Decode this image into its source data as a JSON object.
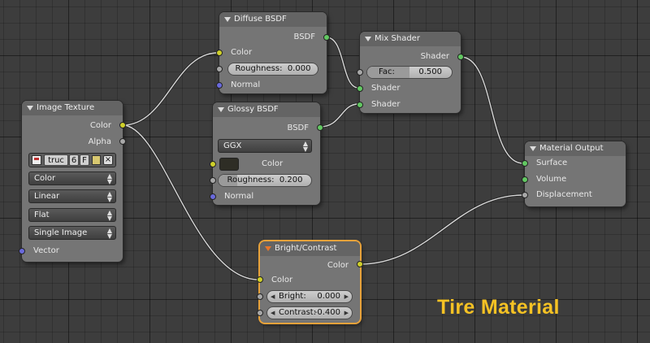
{
  "overlay_title": "Tire Material",
  "nodes": {
    "image_texture": {
      "title": "Image Texture",
      "outputs": [
        "Color",
        "Alpha"
      ],
      "image_name": "truc",
      "users": "6",
      "fake_user": "F",
      "dropdowns": [
        "Color",
        "Linear",
        "Flat",
        "Single Image"
      ],
      "input": "Vector"
    },
    "diffuse": {
      "title": "Diffuse BSDF",
      "output": "BSDF",
      "input_color": "Color",
      "roughness_label": "Roughness:",
      "roughness_value": "0.000",
      "input_normal": "Normal"
    },
    "glossy": {
      "title": "Glossy BSDF",
      "output": "BSDF",
      "distribution": "GGX",
      "input_color": "Color",
      "roughness_label": "Roughness:",
      "roughness_value": "0.200",
      "input_normal": "Normal"
    },
    "mix": {
      "title": "Mix Shader",
      "output": "Shader",
      "fac_label": "Fac:",
      "fac_value": "0.500",
      "fac_fraction": 0.5,
      "input_shader1": "Shader",
      "input_shader2": "Shader"
    },
    "output": {
      "title": "Material Output",
      "inputs": [
        "Surface",
        "Volume",
        "Displacement"
      ]
    },
    "bright_contrast": {
      "title": "Bright/Contrast",
      "output": "Color",
      "input_color": "Color",
      "bright_label": "Bright:",
      "bright_value": "0.000",
      "contrast_label": "Contrast:",
      "contrast_value": "-0.400"
    }
  },
  "colors": {
    "socket_color": "#cfd02a",
    "socket_shader": "#62c862",
    "socket_value": "#a8a8a8",
    "socket_vector": "#6a6adc",
    "active_outline": "#e8a23a",
    "overlay_text": "#f5c224"
  }
}
